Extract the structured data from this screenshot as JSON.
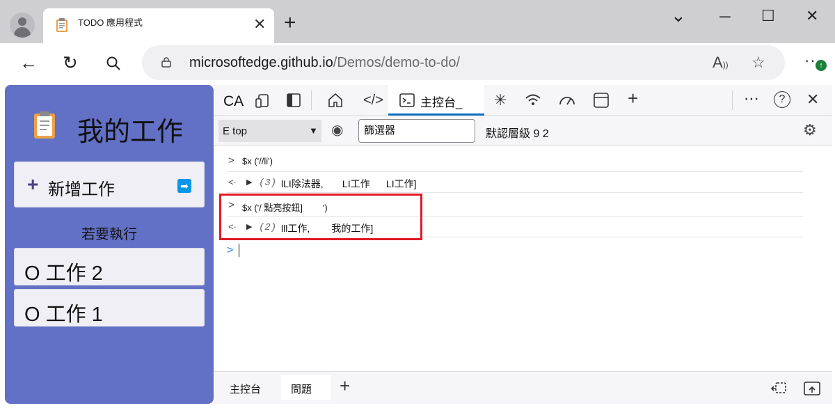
{
  "browser": {
    "tab_title": "TODO 應用程式",
    "tab_close": "✕",
    "new_tab": "+",
    "window_controls": {
      "minimize": "─",
      "restore": "☐",
      "close": "✕",
      "dropdown": "⌄"
    },
    "address": {
      "host": "microsoftedge.github.io",
      "path": "/Demos/demo-to-do/"
    },
    "icons": [
      "back-arrow-icon",
      "refresh-icon",
      "search-icon",
      "lock-icon",
      "read-aloud-icon",
      "favorite-star-icon",
      "more-menu-icon"
    ],
    "update_badge": "↑"
  },
  "app": {
    "title": "我的工作",
    "add_task_label": "新增工作",
    "add_task_plus": "+",
    "add_task_go": "➡",
    "todo_heading": "若要執行",
    "tasks": [
      {
        "label": "O 工作 2"
      },
      {
        "label": "O 工作 1"
      }
    ],
    "colors": {
      "background": "#6270c6",
      "task_bg": "#efeff5"
    }
  },
  "devtools": {
    "toolbar": {
      "ca_label": "CA",
      "console_tab": "主控台_",
      "more": "⋯",
      "help": "?",
      "close": "✕",
      "add": "+"
    },
    "filter_bar": {
      "context": "E top",
      "filter_value": "篩選器",
      "levels": "默認層級 9 2"
    },
    "console_lines": [
      {
        "prefix": ">",
        "code": "$x ('//li')"
      },
      {
        "prefix": "<·",
        "count": "(3)",
        "result": "lLI除法器,       LI工作      LI工作]"
      },
      {
        "prefix": ">",
        "code": "$x ('/ 點亮按鈕]        ')"
      },
      {
        "prefix": "<·",
        "count": "(2)",
        "result": "lll工作,        我的工作]"
      }
    ],
    "prompt": ">",
    "drawer": {
      "tab_console": "主控台",
      "tab_issues": "問題",
      "add": "+"
    },
    "colors": {
      "accent": "#0f6cbd",
      "highlight": "#e01b24",
      "prompt": "#1a73e8"
    }
  }
}
